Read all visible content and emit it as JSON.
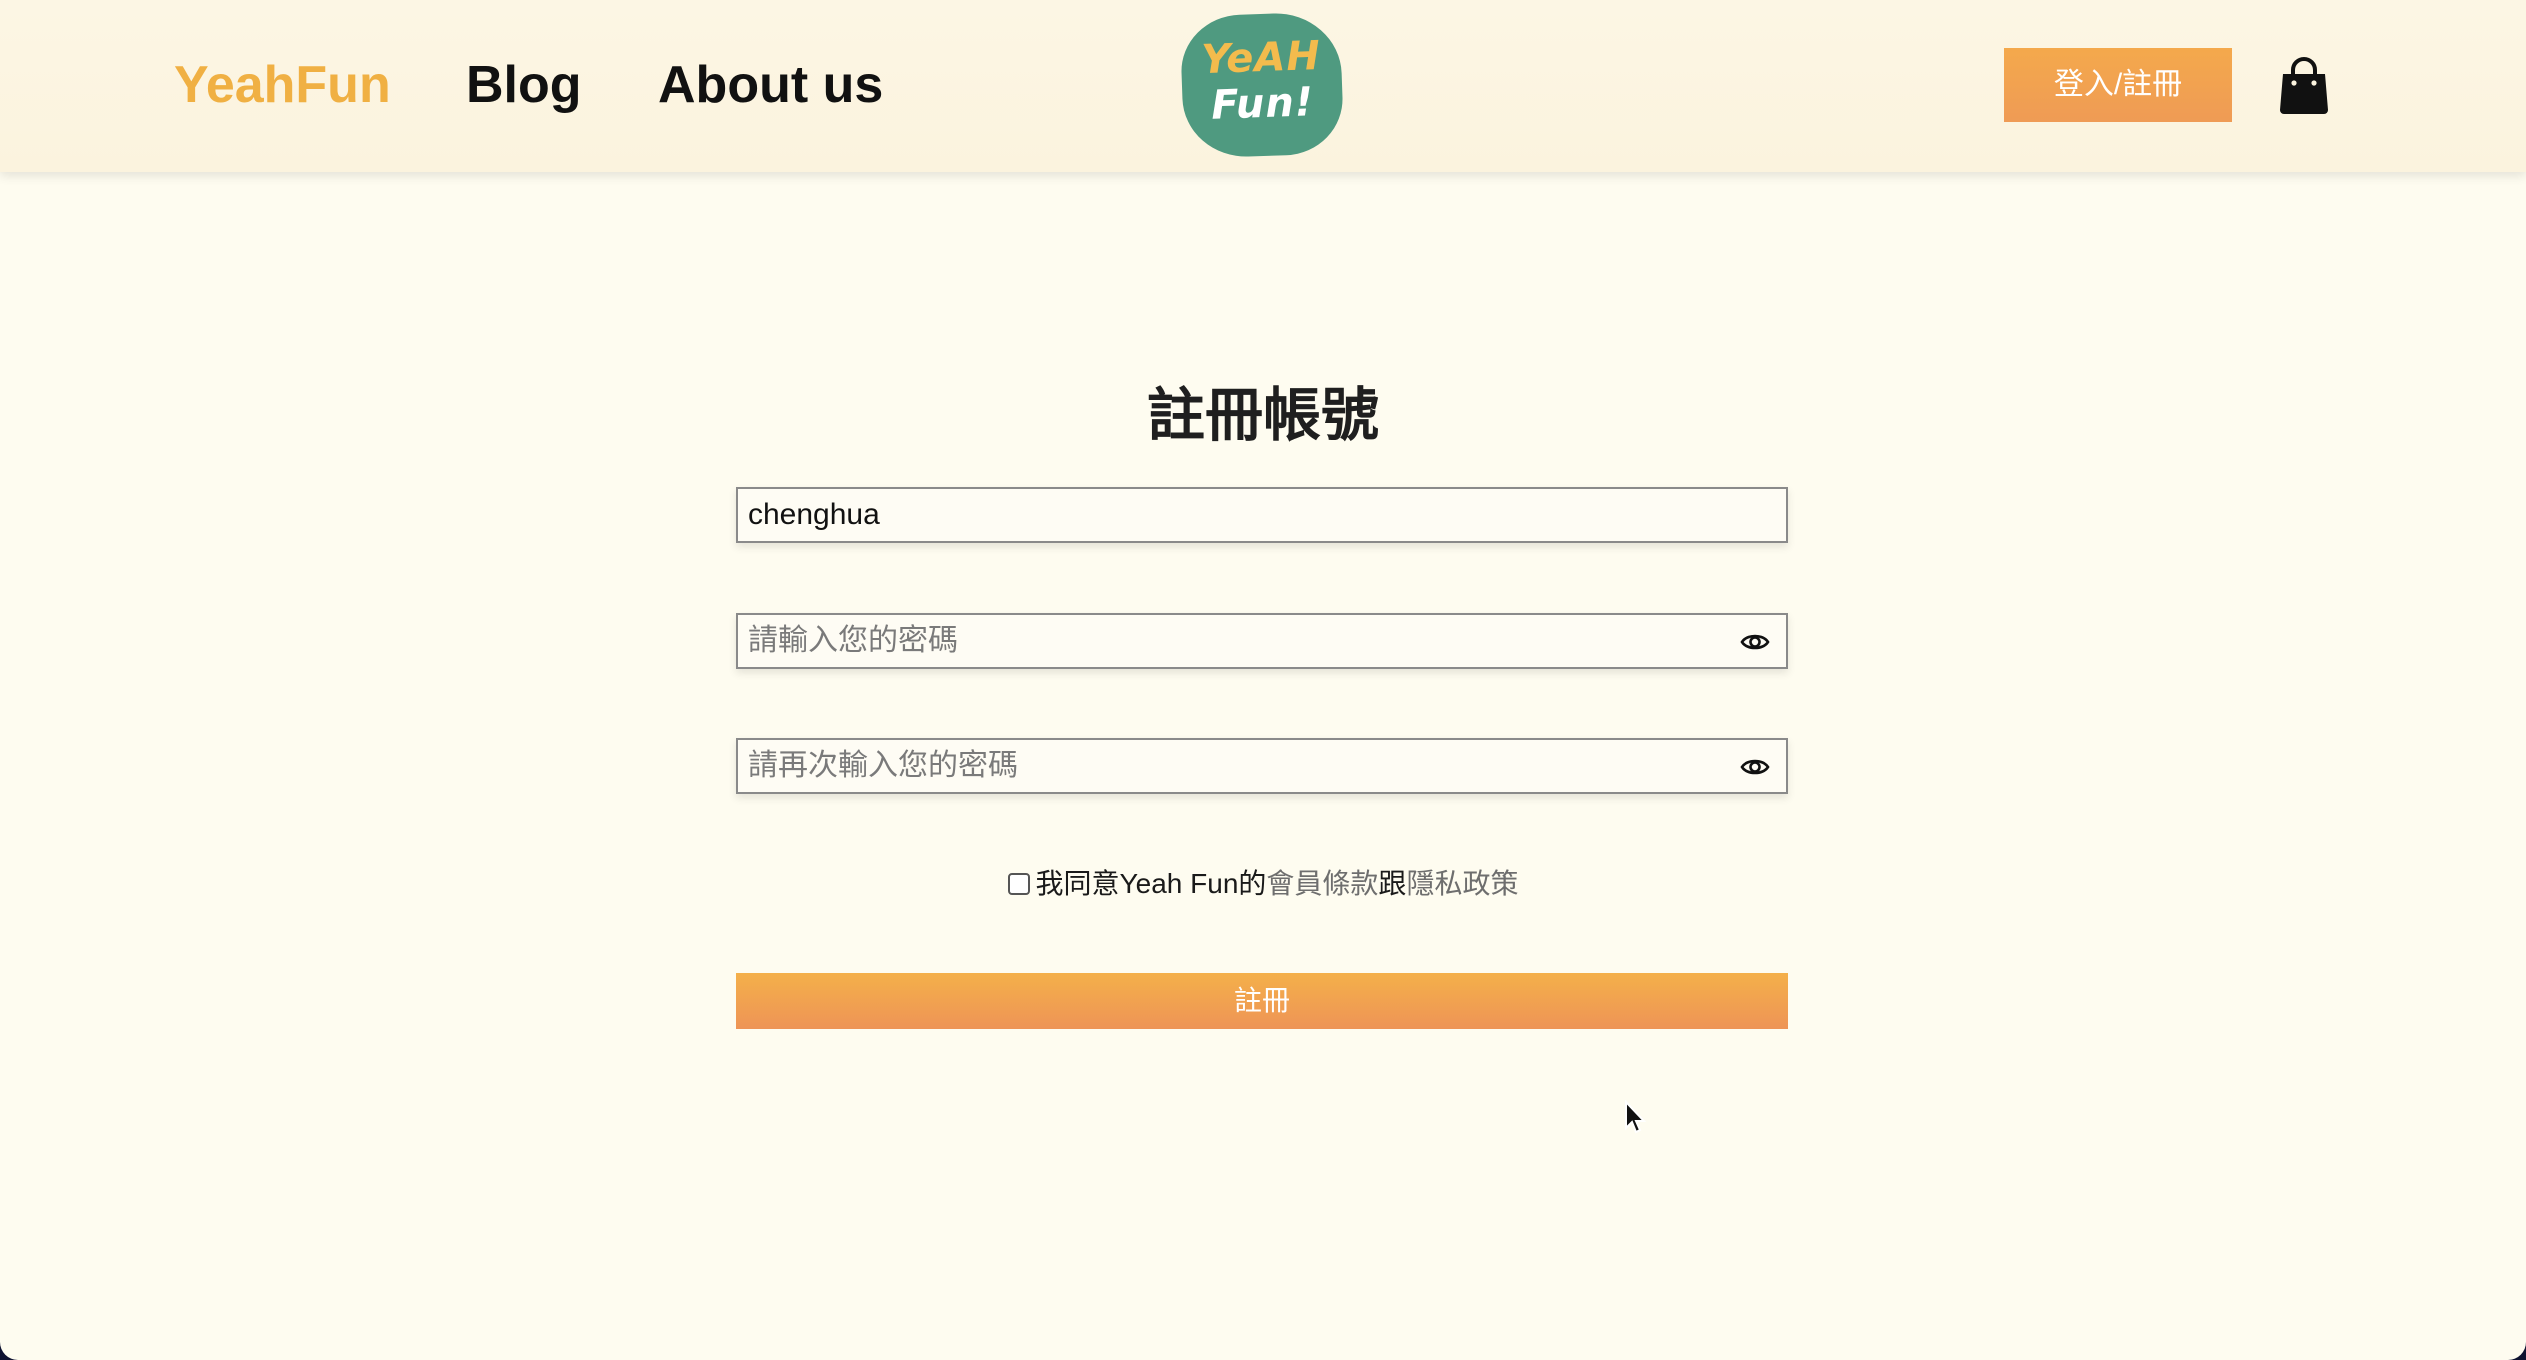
{
  "nav": {
    "brand": "YeahFun",
    "blog": "Blog",
    "about": "About us",
    "logo_line1": "YeAH",
    "logo_line2": "Fun!",
    "login_label": "登入/註冊",
    "cart_icon": "shopping-bag-icon"
  },
  "form": {
    "title": "註冊帳號",
    "username": {
      "value": "chenghua"
    },
    "password": {
      "placeholder": "請輸入您的密碼",
      "value": "",
      "icon": "eye-icon"
    },
    "confirm_password": {
      "placeholder": "請再次輸入您的密碼",
      "value": "",
      "icon": "eye-icon"
    },
    "agree": {
      "checked": false,
      "prefix": "我同意Yeah Fun的",
      "terms_link": "會員條款",
      "middle": "跟",
      "privacy_link": "隱私政策"
    },
    "submit_label": "註冊"
  },
  "colors": {
    "background": "#fefcf0",
    "brand_yellow": "#f0b043",
    "button_orange": "#f1a04f",
    "logo_green": "#4f9a80"
  }
}
